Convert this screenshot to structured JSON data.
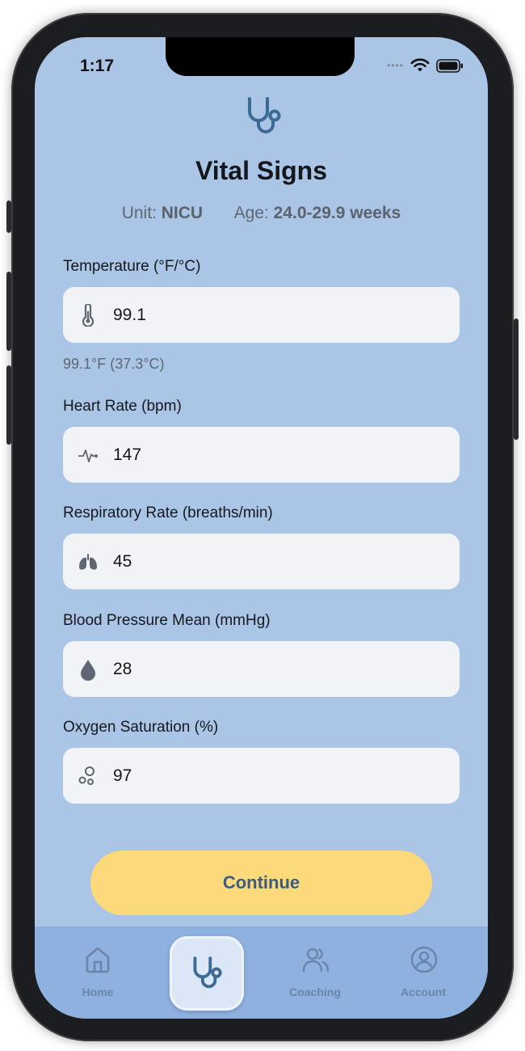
{
  "status_bar": {
    "time": "1:17"
  },
  "header": {
    "icon": "stethoscope-icon",
    "title": "Vital Signs",
    "unit_label": "Unit:",
    "unit_value": "NICU",
    "age_label": "Age:",
    "age_value": "24.0-29.9 weeks"
  },
  "fields": {
    "temperature": {
      "label": "Temperature (°F/°C)",
      "value": "99.1",
      "icon": "thermometer-icon",
      "helper": "99.1°F (37.3°C)"
    },
    "heart_rate": {
      "label": "Heart Rate (bpm)",
      "value": "147",
      "icon": "heartbeat-icon"
    },
    "respiratory_rate": {
      "label": "Respiratory Rate (breaths/min)",
      "value": "45",
      "icon": "lungs-icon"
    },
    "blood_pressure": {
      "label": "Blood Pressure Mean (mmHg)",
      "value": "28",
      "icon": "droplet-icon"
    },
    "oxygen": {
      "label": "Oxygen Saturation (%)",
      "value": "97",
      "icon": "bubbles-icon"
    }
  },
  "actions": {
    "continue_label": "Continue"
  },
  "tabbar": {
    "items": [
      {
        "label": "Home",
        "icon": "home-icon"
      },
      {
        "label": "",
        "icon": "stethoscope-icon",
        "active": true
      },
      {
        "label": "Coaching",
        "icon": "users-icon"
      },
      {
        "label": "Account",
        "icon": "account-icon"
      }
    ]
  },
  "colors": {
    "background": "#abc5e6",
    "accent": "#3b6a93",
    "button": "#fcd97b",
    "field_bg": "#f1f3f6",
    "tabbar_bg": "#8fb1df"
  }
}
